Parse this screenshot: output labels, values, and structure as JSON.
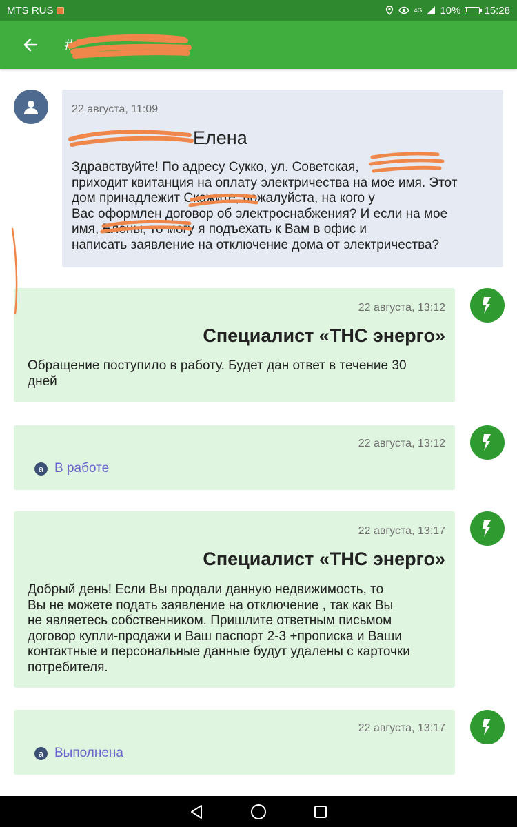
{
  "status_bar": {
    "carrier": "MTS RUS",
    "network": "4G",
    "battery_percent": "10%",
    "battery_level": 0.1,
    "time": "15:28"
  },
  "app_bar": {
    "title": "#",
    "back_icon": "arrow-left-icon"
  },
  "messages": [
    {
      "type": "incoming",
      "time": "22 августа, 11:09",
      "author": "Елена",
      "body": [
        "Здравствуйте! По адресу Сукко, ул. Советская,",
        "приходит квитанция на оплату электричества на мое имя. Этот",
        "дом принадлежит",
        "Скажите, пожалуйста, на кого у",
        "Вас оформлен договор об электроснабжения? И если на мое",
        "имя,",
        "Елены, то могу я подъехать к Вам в офис и",
        "написать заявление на отключение дома от электричества?"
      ],
      "body_lines": [
        "Здравствуйте! По адресу Сукко, ул. Советская,",
        "приходит квитанция на оплату электричества на мое имя. Этот",
        "дом принадлежит  Скажите, пожалуйста, на кого у",
        "Вас оформлен договор об электроснабжения? И если на мое",
        "имя,  Елены, то могу я подъехать к Вам в офис и",
        "написать заявление на отключение дома от электричества?"
      ]
    },
    {
      "type": "outgoing",
      "time": "22 августа, 13:12",
      "author": "Специалист «ТНС энерго»",
      "body_lines": [
        "Обращение поступило в работу. Будет дан ответ в течение 30",
        "дней"
      ]
    },
    {
      "type": "status",
      "time": "22 августа, 13:12",
      "chip_letter": "a",
      "status": "В работе"
    },
    {
      "type": "outgoing",
      "time": "22 августа, 13:17",
      "author": "Специалист «ТНС энерго»",
      "body_lines": [
        "Добрый день! Если Вы продали данную недвижимость, то",
        "Вы не можете подать заявление на отключение , так как Вы",
        "не являетесь собственником. Пришлите ответным письмом",
        "договор купли-продажи и Ваш паспорт 2-3 +прописка и Ваши",
        "контактные и персональные данные будут удалены с карточки",
        "потребителя."
      ]
    },
    {
      "type": "status",
      "time": "22 августа, 13:17",
      "chip_letter": "a",
      "status": "Выполнена"
    }
  ],
  "icons": {
    "user_avatar": "person-icon",
    "company_avatar": "ths-logo-icon",
    "nav_back": "triangle-back-icon",
    "nav_home": "circle-home-icon",
    "nav_recents": "square-recents-icon"
  },
  "colors": {
    "status_bar": "#2f8a2f",
    "app_bar": "#3fae3f",
    "incoming_bubble": "#e6eaf2",
    "outgoing_bubble": "#dff5df",
    "status_link": "#6c66cc",
    "redaction": "#f0874a"
  }
}
